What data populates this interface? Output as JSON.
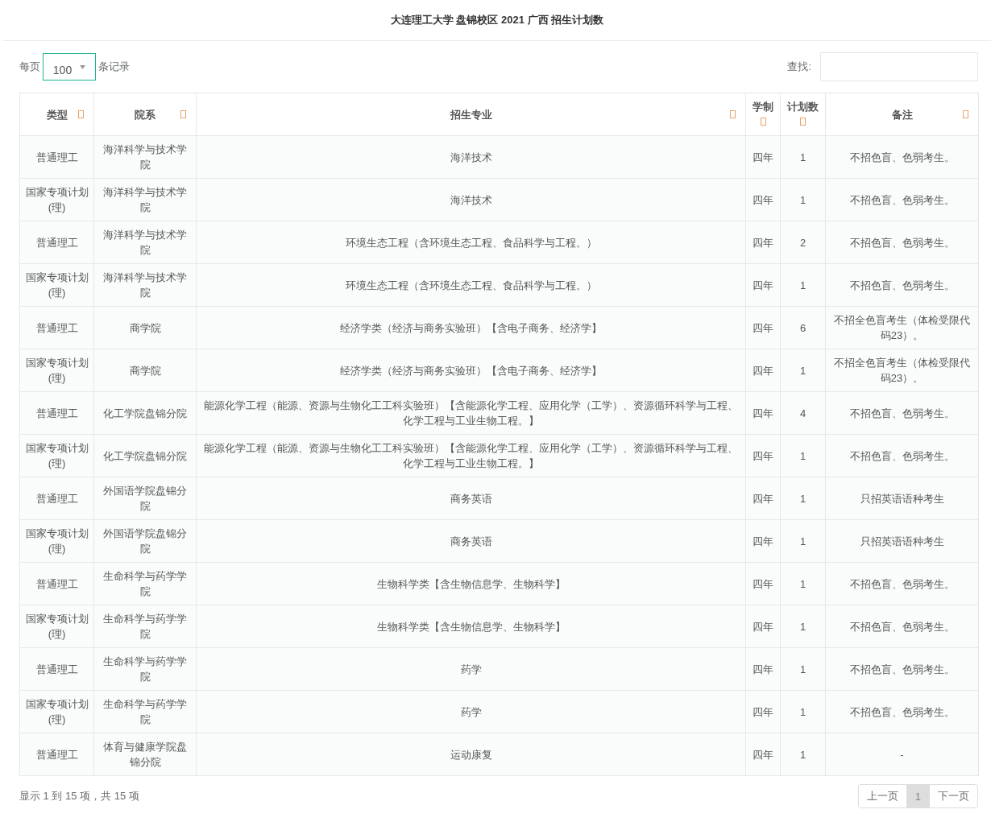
{
  "title": "大连理工大学 盘锦校区 2021 广西 招生计划数",
  "length_control": {
    "prefix": "每页",
    "value": "100",
    "suffix": "条记录"
  },
  "search": {
    "label": "查找:"
  },
  "table": {
    "columns": [
      {
        "label": "类型"
      },
      {
        "label": "院系"
      },
      {
        "label": "招生专业"
      },
      {
        "label": "学制"
      },
      {
        "label": "计划数"
      },
      {
        "label": "备注"
      }
    ],
    "rows": [
      [
        "普通理工",
        "海洋科学与技术学院",
        "海洋技术",
        "四年",
        "1",
        "不招色盲、色弱考生。"
      ],
      [
        "国家专项计划(理)",
        "海洋科学与技术学院",
        "海洋技术",
        "四年",
        "1",
        "不招色盲、色弱考生。"
      ],
      [
        "普通理工",
        "海洋科学与技术学院",
        "环境生态工程（含环境生态工程、食品科学与工程。）",
        "四年",
        "2",
        "不招色盲、色弱考生。"
      ],
      [
        "国家专项计划(理)",
        "海洋科学与技术学院",
        "环境生态工程（含环境生态工程、食品科学与工程。）",
        "四年",
        "1",
        "不招色盲、色弱考生。"
      ],
      [
        "普通理工",
        "商学院",
        "经济学类（经济与商务实验班）【含电子商务、经济学】",
        "四年",
        "6",
        "不招全色盲考生（体检受限代码23）。"
      ],
      [
        "国家专项计划(理)",
        "商学院",
        "经济学类（经济与商务实验班）【含电子商务、经济学】",
        "四年",
        "1",
        "不招全色盲考生（体检受限代码23）。"
      ],
      [
        "普通理工",
        "化工学院盘锦分院",
        "能源化学工程（能源、资源与生物化工工科实验班）【含能源化学工程、应用化学（工学）、资源循环科学与工程、化学工程与工业生物工程。】",
        "四年",
        "4",
        "不招色盲、色弱考生。"
      ],
      [
        "国家专项计划(理)",
        "化工学院盘锦分院",
        "能源化学工程（能源、资源与生物化工工科实验班）【含能源化学工程、应用化学（工学）、资源循环科学与工程、化学工程与工业生物工程。】",
        "四年",
        "1",
        "不招色盲、色弱考生。"
      ],
      [
        "普通理工",
        "外国语学院盘锦分院",
        "商务英语",
        "四年",
        "1",
        "只招英语语种考生"
      ],
      [
        "国家专项计划(理)",
        "外国语学院盘锦分院",
        "商务英语",
        "四年",
        "1",
        "只招英语语种考生"
      ],
      [
        "普通理工",
        "生命科学与药学学院",
        "生物科学类【含生物信息学、生物科学】",
        "四年",
        "1",
        "不招色盲、色弱考生。"
      ],
      [
        "国家专项计划(理)",
        "生命科学与药学学院",
        "生物科学类【含生物信息学、生物科学】",
        "四年",
        "1",
        "不招色盲、色弱考生。"
      ],
      [
        "普通理工",
        "生命科学与药学学院",
        "药学",
        "四年",
        "1",
        "不招色盲、色弱考生。"
      ],
      [
        "国家专项计划(理)",
        "生命科学与药学学院",
        "药学",
        "四年",
        "1",
        "不招色盲、色弱考生。"
      ],
      [
        "普通理工",
        "体育与健康学院盘锦分院",
        "运动康复",
        "四年",
        "1",
        "-"
      ]
    ]
  },
  "info": "显示 1 到 15 项，共 15 项",
  "pagination": [
    {
      "label": "上一页",
      "selected": false
    },
    {
      "label": "1",
      "selected": true
    },
    {
      "label": "下一页",
      "selected": false
    }
  ]
}
